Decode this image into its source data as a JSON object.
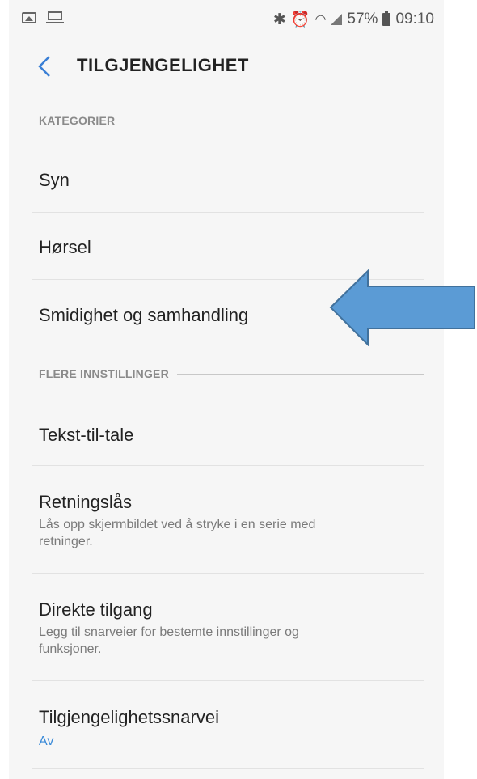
{
  "statusbar": {
    "battery_text": "57%",
    "time": "09:10"
  },
  "header": {
    "title": "TILGJENGELIGHET"
  },
  "sections": [
    {
      "label": "KATEGORIER"
    },
    {
      "label": "FLERE INNSTILLINGER"
    }
  ],
  "items": [
    {
      "title": "Syn",
      "subtitle": ""
    },
    {
      "title": "Hørsel",
      "subtitle": ""
    },
    {
      "title": "Smidighet og samhandling",
      "subtitle": ""
    },
    {
      "title": "Tekst-til-tale",
      "subtitle": ""
    },
    {
      "title": "Retningslås",
      "subtitle": "Lås opp skjermbildet ved å stryke i en serie med retninger."
    },
    {
      "title": "Direkte tilgang",
      "subtitle": "Legg til snarveier for bestemte innstillinger og funksjoner."
    },
    {
      "title": "Tilgjengelighetssnarvei",
      "subtitle": "Av"
    }
  ],
  "colors": {
    "accent": "#3a8ad8",
    "arrow_fill": "#5b9bd5",
    "arrow_stroke": "#41719c"
  }
}
